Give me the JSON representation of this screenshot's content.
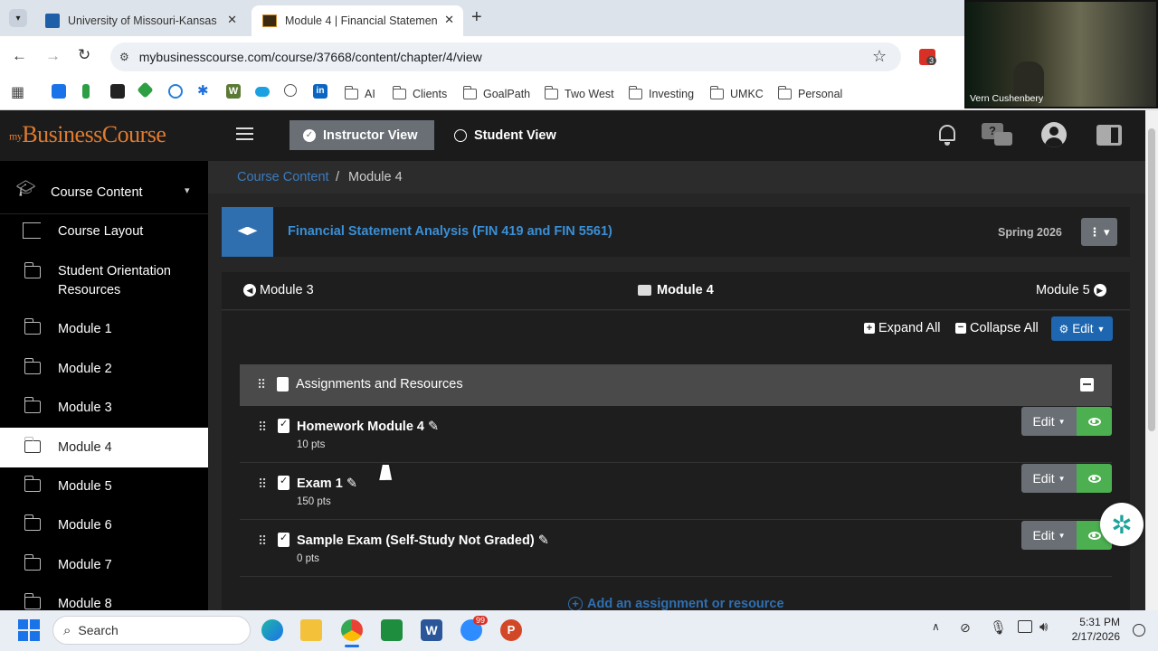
{
  "browser": {
    "tabs": [
      {
        "title": "University of Missouri-Kansas C",
        "active": false
      },
      {
        "title": "Module 4 | Financial Statement",
        "active": true
      }
    ],
    "url": "mybusinesscourse.com/course/37668/content/chapter/4/view",
    "extension_badge": "3",
    "bookmarks": [
      "AI",
      "Clients",
      "GoalPath",
      "Two West",
      "Investing",
      "UMKC",
      "Personal"
    ]
  },
  "video": {
    "name": "Vern Cushenbery"
  },
  "app": {
    "logo_prefix": "my",
    "logo_text": "BusinessCourse",
    "view_toggle": {
      "instructor": "Instructor View",
      "student": "Student View"
    }
  },
  "sidebar": {
    "header": "Course Content",
    "items": [
      {
        "label": "Course Layout"
      },
      {
        "label": "Student Orientation Resources"
      },
      {
        "label": "Module 1"
      },
      {
        "label": "Module 2"
      },
      {
        "label": "Module 3"
      },
      {
        "label": "Module 4",
        "active": true
      },
      {
        "label": "Module 5"
      },
      {
        "label": "Module 6"
      },
      {
        "label": "Module 7"
      },
      {
        "label": "Module 8"
      }
    ]
  },
  "breadcrumb": {
    "link": "Course Content",
    "separator": "/",
    "current": "Module 4"
  },
  "course": {
    "title": "Financial Statement Analysis (FIN 419 and FIN 5561)",
    "term": "Spring 2026"
  },
  "module_nav": {
    "prev": "Module 3",
    "current": "Module 4",
    "next": "Module 5"
  },
  "toolbar": {
    "expand_all": "Expand All",
    "collapse_all": "Collapse All",
    "edit": "Edit"
  },
  "section": {
    "title": "Assignments and Resources"
  },
  "assignments": [
    {
      "title": "Homework Module 4",
      "points": "10 pts",
      "edit_label": "Edit"
    },
    {
      "title": "Exam 1",
      "points": "150 pts",
      "edit_label": "Edit"
    },
    {
      "title": "Sample Exam (Self-Study Not Graded)",
      "points": "0 pts",
      "edit_label": "Edit"
    }
  ],
  "add_resource": "Add an assignment or resource",
  "taskbar": {
    "search_placeholder": "Search",
    "zoom_badge": "99",
    "time": "5:31 PM",
    "date": "2/17/2026"
  },
  "colors": {
    "accent_blue": "#3a7bbf",
    "header_dark": "#1b1b1b",
    "eye_green": "#4caf50",
    "edit_gray": "#6a6f75",
    "logo_orange": "#e07a2f"
  }
}
